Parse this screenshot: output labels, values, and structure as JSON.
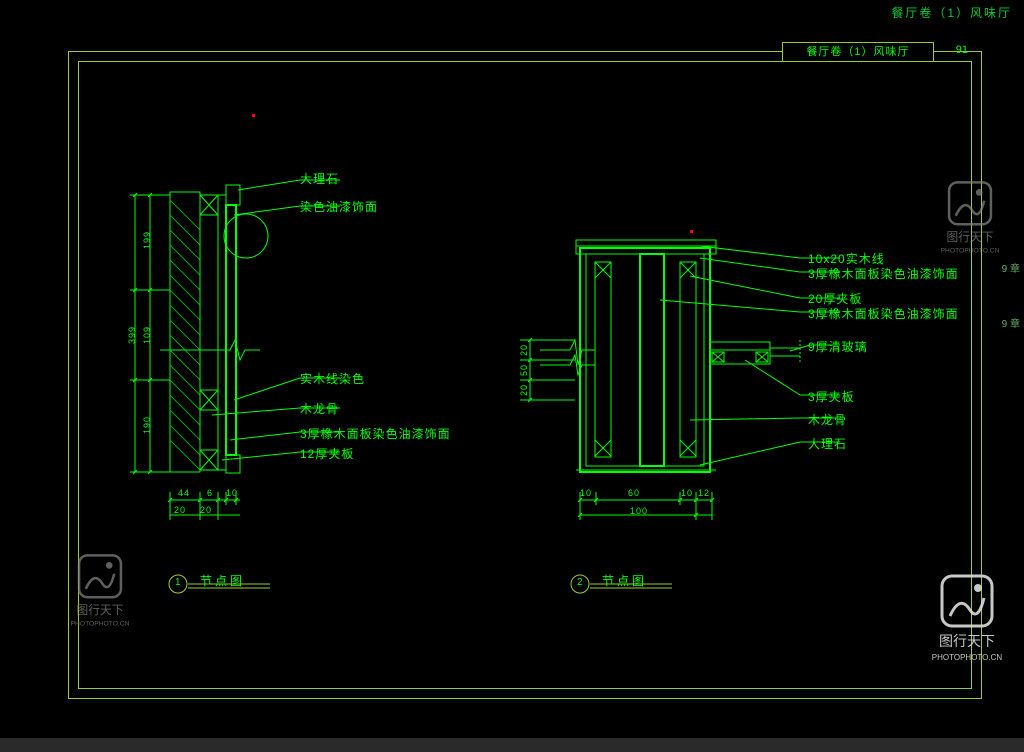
{
  "header": {
    "top_title": "餐厅卷（1）风味厅",
    "frame_title": "餐厅卷（1）风味厅",
    "page_number": "91"
  },
  "detail1": {
    "title": "节点图",
    "title_num": "1",
    "labels": {
      "l1": "大理石",
      "l2": "染色油漆饰面",
      "l3": "实木线染色",
      "l4": "木龙骨",
      "l5": "3厚橡木面板染色油漆饰面",
      "l6": "12厚夹板"
    },
    "dims": {
      "v1": "199",
      "v2": "109",
      "v3": "190",
      "v4": "399",
      "h1": "44",
      "h2": "6",
      "h3": "10",
      "h4": "20",
      "h5": "20"
    }
  },
  "detail2": {
    "title": "节点图",
    "title_num": "2",
    "labels": {
      "r1": "10x20实木线",
      "r2": "3厚橡木面板染色油漆饰面",
      "r3": "20厚夹板",
      "r4": "3厚橡木面板染色油漆饰面",
      "r5": "9厚清玻璃",
      "r6": "3厚夹板",
      "r7": "木龙骨",
      "r8": "大理石"
    },
    "dims": {
      "v1": "20",
      "v2": "50",
      "v3": "20",
      "h1": "10",
      "h2": "60",
      "h3": "10",
      "h4": "12",
      "h5": "100"
    }
  },
  "right_margin": {
    "t1": "9 章",
    "t2": "9 章"
  },
  "watermark": {
    "brand": "图行天下",
    "url": "PHOTOPHOTO.CN"
  }
}
